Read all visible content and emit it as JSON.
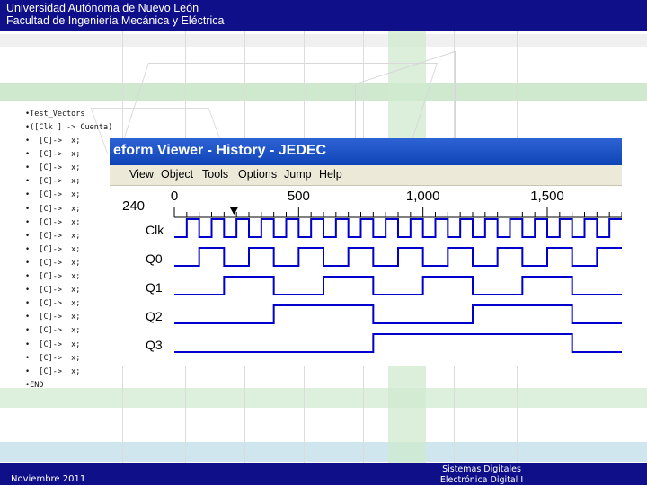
{
  "slide": {
    "header_line1": "Universidad Autónoma de Nuevo León",
    "header_line2": "Facultad de Ingeniería Mecánica y Eléctrica",
    "footer_date": "Noviembre  2011",
    "footer_course1": "Sistemas Digitales",
    "footer_course2": "Electrónica Digital I",
    "header_color": "#0f0f8a",
    "band_colors": [
      "#cfe9cf",
      "#cfe6ef"
    ]
  },
  "code": {
    "title": "•Test_Vectors",
    "declaration": "•([Clk ] -> Cuenta)",
    "vector_line": "•  [C]->  x;",
    "vector_count": 18,
    "end": "•END"
  },
  "viewer": {
    "title": "eform Viewer - History - JEDEC",
    "menu": [
      "View",
      "Object",
      "Tools",
      "Options",
      "Jump",
      "Help"
    ],
    "cursor_value": "240",
    "time_ticks": [
      "0",
      "500",
      "1,000",
      "1,500"
    ],
    "time_tick_values": [
      0,
      500,
      1000,
      1500
    ],
    "cursor_time": 240,
    "time_range": [
      0,
      1800
    ],
    "clock_period": 100,
    "signals": [
      {
        "name": "Clk",
        "divide": 1
      },
      {
        "name": "Q0",
        "divide": 2
      },
      {
        "name": "Q1",
        "divide": 4
      },
      {
        "name": "Q2",
        "divide": 8
      },
      {
        "name": "Q3",
        "divide": 16
      }
    ],
    "wave_color": "#0000cc"
  }
}
